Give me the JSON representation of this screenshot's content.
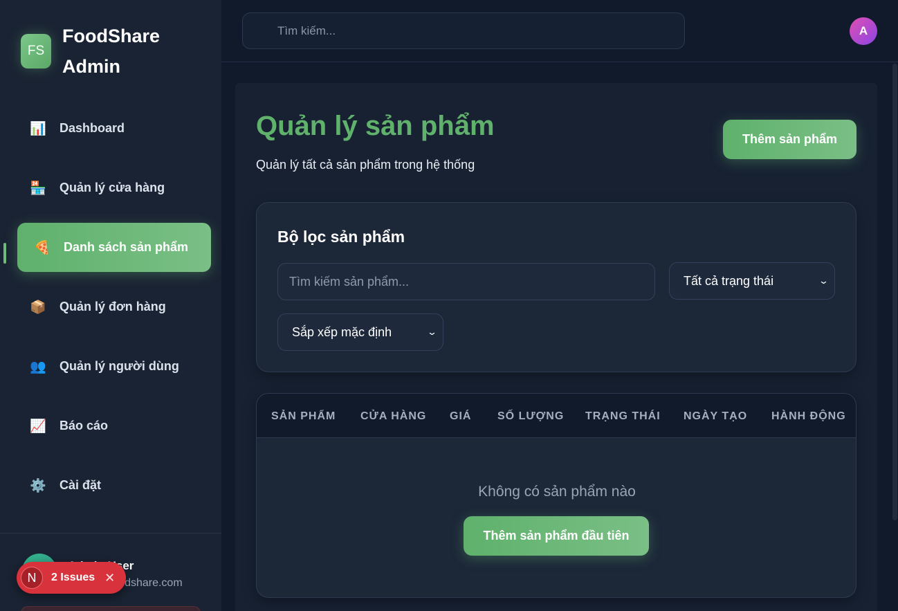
{
  "brand": {
    "logo_text": "FS",
    "name": "FoodShare Admin"
  },
  "sidebar": {
    "items": [
      {
        "label": "Dashboard",
        "icon": "bar-chart-icon",
        "glyph": "📊"
      },
      {
        "label": "Quản lý cửa hàng",
        "icon": "store-icon",
        "glyph": "🏪"
      },
      {
        "label": "Danh sách sản phẩm",
        "icon": "pizza-icon",
        "glyph": "🍕",
        "active": true
      },
      {
        "label": "Quản lý đơn hàng",
        "icon": "package-icon",
        "glyph": "📦"
      },
      {
        "label": "Quản lý người dùng",
        "icon": "users-icon",
        "glyph": "👥"
      },
      {
        "label": "Báo cáo",
        "icon": "trend-chart-icon",
        "glyph": "📈"
      },
      {
        "label": "Cài đặt",
        "icon": "gear-icon",
        "glyph": "⚙️"
      }
    ],
    "user": {
      "name": "Admin User",
      "email": "admin@foodshare.com"
    }
  },
  "issues_badge": {
    "logo": "N",
    "label": "2 Issues",
    "close": "✕"
  },
  "topbar": {
    "search_placeholder": "Tìm kiếm...",
    "avatar_letter": "A"
  },
  "main": {
    "title": "Quản lý sản phẩm",
    "subtitle": "Quản lý tất cả sản phẩm trong hệ thống",
    "add_button": "Thêm sản phẩm",
    "filter": {
      "title": "Bộ lọc sản phẩm",
      "search_placeholder": "Tìm kiếm sản phẩm...",
      "status_selected": "Tất cả trạng thái",
      "sort_selected": "Sắp xếp mặc định"
    },
    "table": {
      "columns": [
        "SẢN PHẨM",
        "CỬA HÀNG",
        "GIÁ",
        "SỐ LƯỢNG",
        "TRẠNG THÁI",
        "NGÀY TẠO",
        "HÀNH ĐỘNG"
      ],
      "empty_text": "Không có sản phẩm nào",
      "empty_button": "Thêm sản phẩm đầu tiên"
    }
  },
  "colors": {
    "accent": "#5fb16c",
    "sidebar_bg": "#1a2333",
    "page_bg": "#111a2b",
    "issues_red": "#d8333c"
  }
}
